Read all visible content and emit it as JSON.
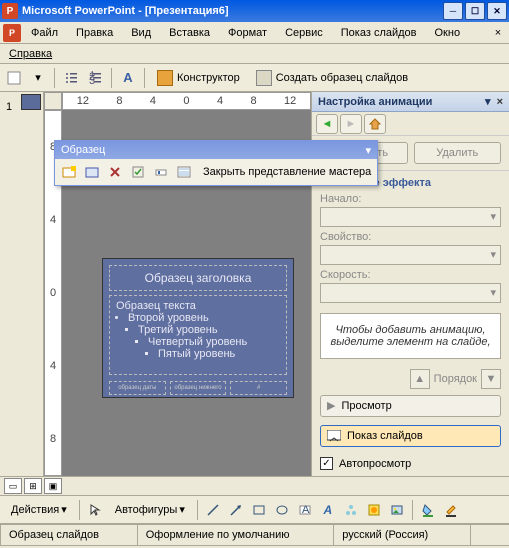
{
  "titlebar": {
    "app": "Microsoft PowerPoint",
    "doc": "[Презентация6]"
  },
  "menu": {
    "file": "Файл",
    "edit": "Правка",
    "view": "Вид",
    "insert": "Вставка",
    "format": "Формат",
    "tools": "Сервис",
    "slideshow": "Показ слайдов",
    "window": "Окно",
    "help": "Справка"
  },
  "toolbar": {
    "designer": "Конструктор",
    "create_master": "Создать образец слайдов"
  },
  "ruler_h": [
    "12",
    "8",
    "4",
    "0",
    "4",
    "8",
    "12"
  ],
  "ruler_v": [
    "8",
    "4",
    "0",
    "4",
    "8"
  ],
  "thumb": {
    "index": "1"
  },
  "master_slide": {
    "title_ph": "Образец заголовка",
    "body_ph": "Образец текста",
    "lvl2": "Второй уровень",
    "lvl3": "Третий уровень",
    "lvl4": "Четвертый уровень",
    "lvl5": "Пятый уровень",
    "foot1": "образец даты",
    "foot2": "образец нижнего",
    "foot3": "#"
  },
  "floatbar": {
    "title": "Образец",
    "close_label": "Закрыть представление мастера"
  },
  "anim_pane": {
    "title": "Настройка анимации",
    "add": "Добавить",
    "remove": "Удалить",
    "group": "Изменение эффекта",
    "start": "Начало:",
    "property": "Свойство:",
    "speed": "Скорость:",
    "hint": "Чтобы добавить анимацию, выделите элемент на слайде,",
    "order": "Порядок",
    "preview": "Просмотр",
    "slideshow": "Показ слайдов",
    "autopreview": "Автопросмотр"
  },
  "drawbar": {
    "actions": "Действия",
    "autoshapes": "Автофигуры"
  },
  "status": {
    "s1": "Образец слайдов",
    "s2": "Оформление по умолчанию",
    "s3": "русский (Россия)"
  }
}
